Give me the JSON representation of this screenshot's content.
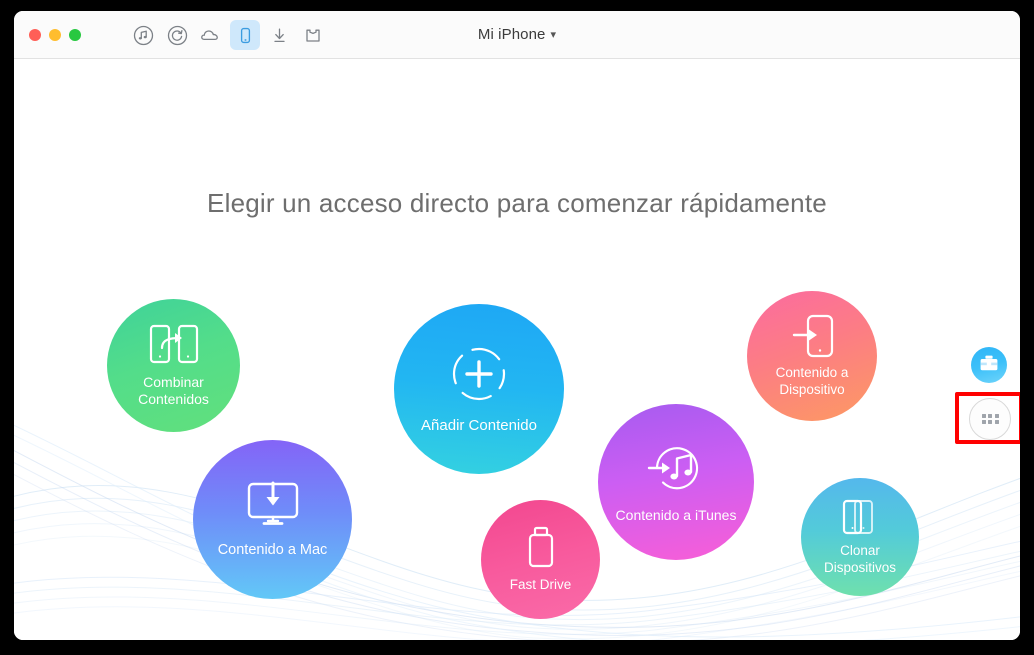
{
  "window": {
    "title": "Mi iPhone",
    "title_chevron": "chevron-down-icon",
    "traffic_lights": [
      {
        "name": "close",
        "color": "#ff5f57"
      },
      {
        "name": "minimize",
        "color": "#ffbd2e"
      },
      {
        "name": "maximize",
        "color": "#28c840"
      }
    ]
  },
  "toolbar": {
    "items": [
      {
        "icon": "music-note-icon",
        "label": "Music",
        "active": false
      },
      {
        "icon": "refresh-circle-icon",
        "label": "Refresh",
        "active": false
      },
      {
        "icon": "cloud-icon",
        "label": "Cloud",
        "active": false
      },
      {
        "icon": "device-phone-icon",
        "label": "Device",
        "active": true
      },
      {
        "icon": "download-arrow-icon",
        "label": "Download",
        "active": false
      },
      {
        "icon": "tshirt-ringtone-icon",
        "label": "Ringtones",
        "active": false
      }
    ]
  },
  "main": {
    "headline": "Elegir un acceso directo para comenzar rápidamente",
    "shortcuts": [
      {
        "id": "combinar",
        "label": "Combinar\nContenidos",
        "label_line1": "Combinar",
        "label_line2": "Contenidos",
        "icon": "merge-devices-icon",
        "color_start": "#3fd29a",
        "color_end": "#62e07c"
      },
      {
        "id": "anadir",
        "label": "Añadir Contenido",
        "label_line1": "Añadir Contenido",
        "label_line2": "",
        "icon": "add-plus-circle-icon",
        "color_start": "#1ea7f5",
        "color_end": "#34d2e0"
      },
      {
        "id": "dispositivo",
        "label": "Contenido a Dispositivo",
        "label_line1": "Contenido a",
        "label_line2": "Dispositivo",
        "icon": "to-device-arrow-icon",
        "color_start": "#fb6ba0",
        "color_end": "#fd9a62"
      },
      {
        "id": "mac",
        "label": "Contenido a Mac",
        "label_line1": "Contenido a Mac",
        "label_line2": "",
        "icon": "to-mac-monitor-icon",
        "color_start": "#8464f7",
        "color_end": "#62c8f7"
      },
      {
        "id": "itunes",
        "label": "Contenido a iTunes",
        "label_line1": "Contenido a iTunes",
        "label_line2": "",
        "icon": "to-itunes-music-icon",
        "color_start": "#a65bf0",
        "color_end": "#f95ed6"
      },
      {
        "id": "fastdrive",
        "label": "Fast Drive",
        "label_line1": "Fast Drive",
        "label_line2": "",
        "icon": "usb-drive-icon",
        "color_start": "#f2478f",
        "color_end": "#fa6ba8"
      },
      {
        "id": "clonar",
        "label": "Clonar Dispositivos",
        "label_line1": "Clonar",
        "label_line2": "Dispositivos",
        "icon": "clone-devices-icon",
        "color_start": "#54b8ec",
        "color_end": "#6fe0ad"
      }
    ]
  },
  "side_buttons": {
    "toolbox": {
      "icon": "toolbox-icon",
      "color": "#3cc0f9"
    },
    "apps": {
      "icon": "apps-grid-icon",
      "highlight_color": "#ff0000",
      "highlighted": true
    }
  }
}
